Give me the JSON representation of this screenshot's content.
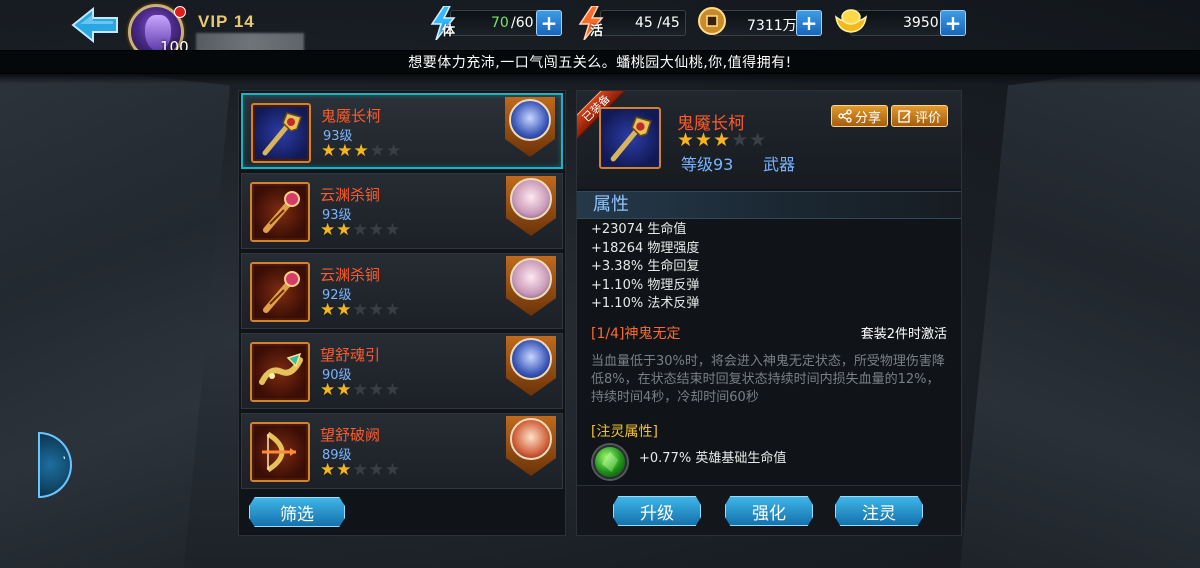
{
  "player": {
    "vip": "VIP 14",
    "avatar_level": "100"
  },
  "resources": {
    "stamina": {
      "label": "体",
      "current": "70",
      "max": "/60"
    },
    "vitality": {
      "label": "活",
      "value": "45 /45"
    },
    "copper": {
      "value": "7311万"
    },
    "gold": {
      "value": "3950"
    }
  },
  "marquee": "想要体力充沛,一口气闯五关么。蟠桃园大仙桃,你,值得拥有!",
  "items": [
    {
      "name": "鬼魇长柯",
      "level": "93级",
      "stars": 3,
      "selected": true
    },
    {
      "name": "云渊杀锏",
      "level": "93级",
      "stars": 2,
      "selected": false
    },
    {
      "name": "云渊杀锏",
      "level": "92级",
      "stars": 2,
      "selected": false
    },
    {
      "name": "望舒魂引",
      "level": "90级",
      "stars": 2,
      "selected": false
    },
    {
      "name": "望舒破阙",
      "level": "89级",
      "stars": 2,
      "selected": false
    }
  ],
  "filter_label": "筛选",
  "detail": {
    "equipped_label": "已装备",
    "name": "鬼魇长柯",
    "stars": 3,
    "level": "等级93",
    "type": "武器",
    "share_label": "分享",
    "review_label": "评价",
    "attr_title": "属性",
    "attrs": [
      "+23074 生命值",
      "+18264 物理强度",
      "+3.38% 生命回复",
      "+1.10% 物理反弹",
      "+1.10% 法术反弹"
    ],
    "set_title": "[1/4]神鬼无定",
    "set_condition": "套装2件时激活",
    "set_desc": "当血量低于30%时，将会进入神鬼无定状态，所受物理伤害降低8%，在状态结束时回复状态持续时间内损失血量的12%，持续时间4秒，冷却时间60秒",
    "spirit_title": "[注灵属性]",
    "spirit_attr": "+0.77% 英雄基础生命值"
  },
  "actions": {
    "upgrade": "升级",
    "enhance": "强化",
    "infuse": "注灵"
  },
  "colors": {
    "accent_blue": "#1571ad",
    "item_name": "#ff5a2a",
    "level_blue": "#79b4ff",
    "star": "#f5b521",
    "selected_border": "#19b3c8"
  }
}
